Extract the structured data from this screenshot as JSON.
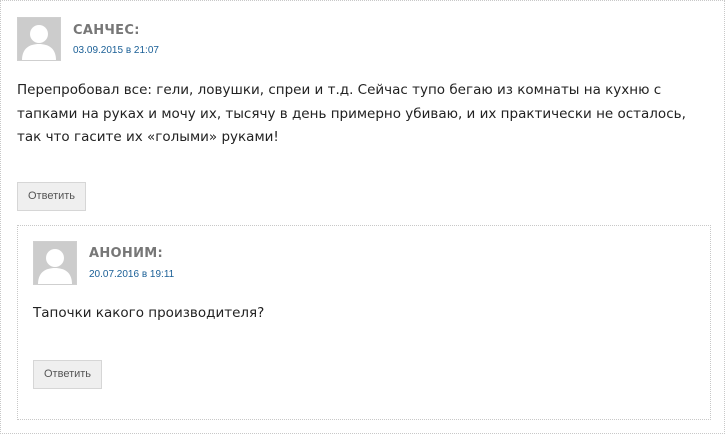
{
  "comments": [
    {
      "author": "САНЧЕС:",
      "date": "03.09.2015 в 21:07",
      "text": "Перепробовал все: гели, ловушки, спреи и т.д. Сейчас тупо бегаю из комнаты на кухню с тапками на руках и мочу их, тысячу в день примерно убиваю, и их практически не осталось, так что гасите их «голыми» руками!",
      "reply_label": "Ответить",
      "avatar_icon": "default-avatar-icon",
      "replies": [
        {
          "author": "АНОНИМ:",
          "date": "20.07.2016 в 19:11",
          "text": "Тапочки какого производителя?",
          "reply_label": "Ответить",
          "avatar_icon": "default-avatar-icon"
        }
      ]
    }
  ],
  "colors": {
    "author": "#777777",
    "date_link": "#1a5f96",
    "button_bg": "#efefef",
    "border": "#c8c8c8",
    "avatar_bg": "#cccccc"
  }
}
